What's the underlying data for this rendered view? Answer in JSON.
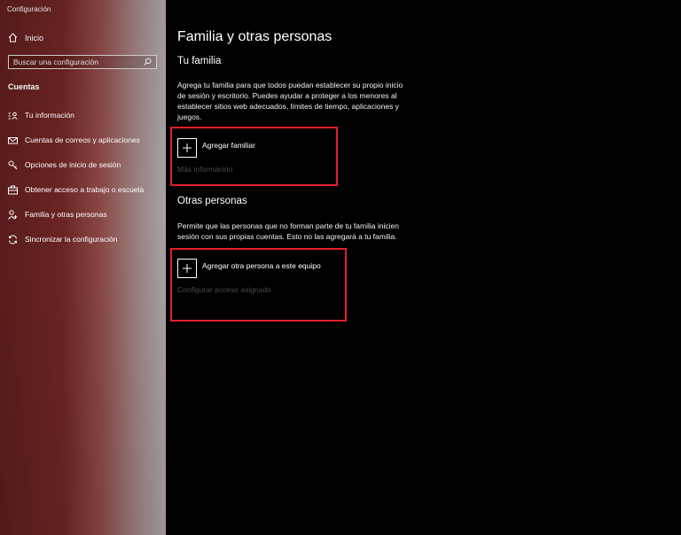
{
  "window": {
    "title": "Configuración"
  },
  "sidebar": {
    "home_label": "Inicio",
    "search_placeholder": "Buscar una configuración",
    "section_title": "Cuentas",
    "items": [
      {
        "label": "Tu información",
        "icon": "person-card-icon"
      },
      {
        "label": "Cuentas de correos y aplicaciones",
        "icon": "mail-icon"
      },
      {
        "label": "Opciones de inicio de sesión",
        "icon": "key-icon"
      },
      {
        "label": "Obtener acceso a trabajo o escuela",
        "icon": "briefcase-icon"
      },
      {
        "label": "Familia y otras personas",
        "icon": "person-add-icon"
      },
      {
        "label": "Sincronizar la configuración",
        "icon": "sync-icon"
      }
    ]
  },
  "main": {
    "title": "Familia y otras personas",
    "family": {
      "heading": "Tu familia",
      "description": "Agrega tu familia para que todos puedan establecer su propio inicio de sesión y escritorio. Puedes ayudar a proteger a los menores al establecer sitios web adecuados, límites de tiempo, aplicaciones y juegos.",
      "add_label": "Agregar familiar",
      "more_info": "Más información"
    },
    "others": {
      "heading": "Otras personas",
      "description": "Permite que las personas que no forman parte de tu familia inicien sesión con sus propias cuentas. Esto no las agregará a tu familia.",
      "add_label": "Agregar otra persona a este equipo",
      "assigned_access": "Configurar acceso asignado"
    }
  },
  "colors": {
    "highlight": "#e0202a",
    "background": "#000000",
    "disabled_text": "#4a4a4a"
  }
}
